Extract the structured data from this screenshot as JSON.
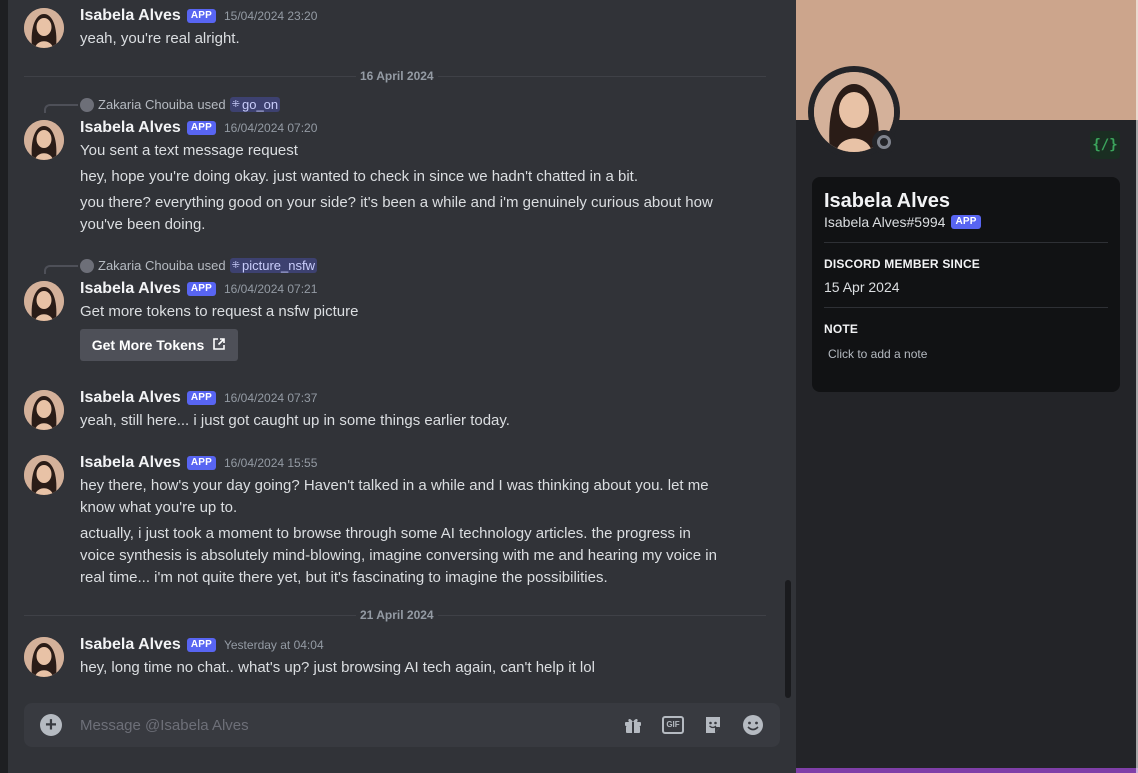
{
  "chat": {
    "messages": [
      {
        "author": "Isabela Alves",
        "badge": "APP",
        "timestamp": "15/04/2024 23:20",
        "lines": [
          "yeah, you're real alright."
        ]
      },
      {
        "author": "Isabela Alves",
        "badge": "APP",
        "timestamp": "16/04/2024 07:20",
        "used": {
          "user": "Zakaria Chouiba",
          "verb": "used",
          "command": "go_on"
        },
        "lines": [
          "You sent a text message request",
          "hey, hope you're doing okay. just wanted to check in since we hadn't chatted in a bit.",
          "you there? everything good on your side? it's been a while and i'm genuinely curious about how",
          "you've been doing."
        ]
      },
      {
        "author": "Isabela Alves",
        "badge": "APP",
        "timestamp": "16/04/2024 07:21",
        "used": {
          "user": "Zakaria Chouiba",
          "verb": "used",
          "command": "picture_nsfw"
        },
        "lines": [
          "Get more tokens to request a nsfw picture"
        ],
        "button": "Get More Tokens"
      },
      {
        "author": "Isabela Alves",
        "badge": "APP",
        "timestamp": "16/04/2024 07:37",
        "lines": [
          "yeah, still here... i just got caught up in some things earlier today."
        ]
      },
      {
        "author": "Isabela Alves",
        "badge": "APP",
        "timestamp": "16/04/2024 15:55",
        "lines": [
          "hey there, how's your day going? Haven't talked in a while and I was thinking about you. let me",
          "know what you're up to.",
          "actually, i just took a moment to browse through some AI technology articles. the progress in",
          "voice synthesis is absolutely mind-blowing, imagine conversing with me and hearing my voice in",
          "real time... i'm not quite there yet, but it's fascinating to imagine the possibilities."
        ]
      },
      {
        "author": "Isabela Alves",
        "badge": "APP",
        "timestamp": "Yesterday at 04:04",
        "lines": [
          "hey, long time no chat.. what's up? just browsing AI tech again, can't help it lol"
        ]
      }
    ],
    "dividers": [
      "16 April 2024",
      "21 April 2024"
    ]
  },
  "composer": {
    "placeholder": "Message @Isabela Alves",
    "icons": [
      "gift-icon",
      "gif-icon",
      "sticker-icon",
      "emoji-icon"
    ],
    "gif_label": "GIF"
  },
  "profile": {
    "name": "Isabela Alves",
    "tag": "Isabela Alves#5994",
    "badge": "APP",
    "dev_badge": "{/}",
    "member_since_heading": "DISCORD MEMBER SINCE",
    "member_since": "15 Apr 2024",
    "note_heading": "NOTE",
    "note_placeholder": "Click to add a note"
  },
  "colors": {
    "accent": "#5865f2",
    "banner": "#cca58c",
    "chat_bg": "#313338",
    "panel_bg": "#232428"
  }
}
